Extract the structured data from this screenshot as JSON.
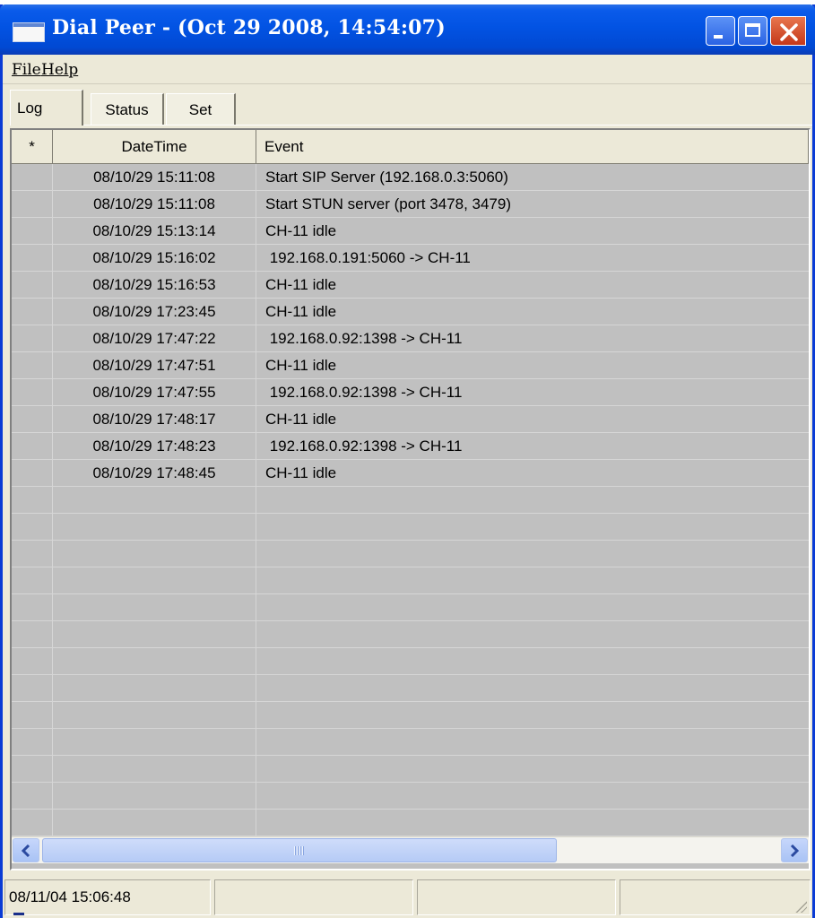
{
  "window": {
    "title": "Dial Peer - (Oct 29 2008, 14:54:07)",
    "icon": "app-window-icon",
    "controls": [
      "minimize-icon",
      "maximize-icon",
      "close-icon"
    ]
  },
  "menu": {
    "file_label": "File",
    "help_label": "Help"
  },
  "tabs": {
    "log": "Log",
    "status": "Status",
    "set": "Set",
    "active": "Log"
  },
  "log_table": {
    "headers": {
      "star": "*",
      "datetime": "DateTime",
      "event": "Event"
    },
    "rows": [
      {
        "datetime": "08/10/29 15:11:08",
        "event": "Start SIP Server (192.168.0.3:5060)"
      },
      {
        "datetime": "08/10/29 15:11:08",
        "event": "Start STUN server (port 3478, 3479)"
      },
      {
        "datetime": "08/10/29 15:13:14",
        "event": "CH-11 idle"
      },
      {
        "datetime": "08/10/29 15:16:02",
        "event": " 192.168.0.191:5060 -> CH-11"
      },
      {
        "datetime": "08/10/29 15:16:53",
        "event": "CH-11 idle"
      },
      {
        "datetime": "08/10/29 17:23:45",
        "event": "CH-11 idle"
      },
      {
        "datetime": "08/10/29 17:47:22",
        "event": " 192.168.0.92:1398 -> CH-11"
      },
      {
        "datetime": "08/10/29 17:47:51",
        "event": "CH-11 idle"
      },
      {
        "datetime": "08/10/29 17:47:55",
        "event": " 192.168.0.92:1398 -> CH-11"
      },
      {
        "datetime": "08/10/29 17:48:17",
        "event": "CH-11 idle"
      },
      {
        "datetime": "08/10/29 17:48:23",
        "event": " 192.168.0.92:1398 -> CH-11"
      },
      {
        "datetime": "08/10/29 17:48:45",
        "event": "CH-11 idle"
      },
      {
        "datetime": "",
        "event": ""
      },
      {
        "datetime": "",
        "event": ""
      },
      {
        "datetime": "",
        "event": ""
      },
      {
        "datetime": "",
        "event": ""
      },
      {
        "datetime": "",
        "event": ""
      },
      {
        "datetime": "",
        "event": ""
      },
      {
        "datetime": "",
        "event": ""
      },
      {
        "datetime": "",
        "event": ""
      },
      {
        "datetime": "",
        "event": ""
      },
      {
        "datetime": "",
        "event": ""
      },
      {
        "datetime": "",
        "event": ""
      },
      {
        "datetime": "",
        "event": ""
      },
      {
        "datetime": "",
        "event": ""
      }
    ]
  },
  "statusbar": {
    "panels": [
      "08/11/04 15:06:48",
      "",
      "",
      ""
    ]
  },
  "colors": {
    "titlebar": "#0253e3",
    "grid_background": "#c0c0c0",
    "window_face": "#ece9d8"
  }
}
